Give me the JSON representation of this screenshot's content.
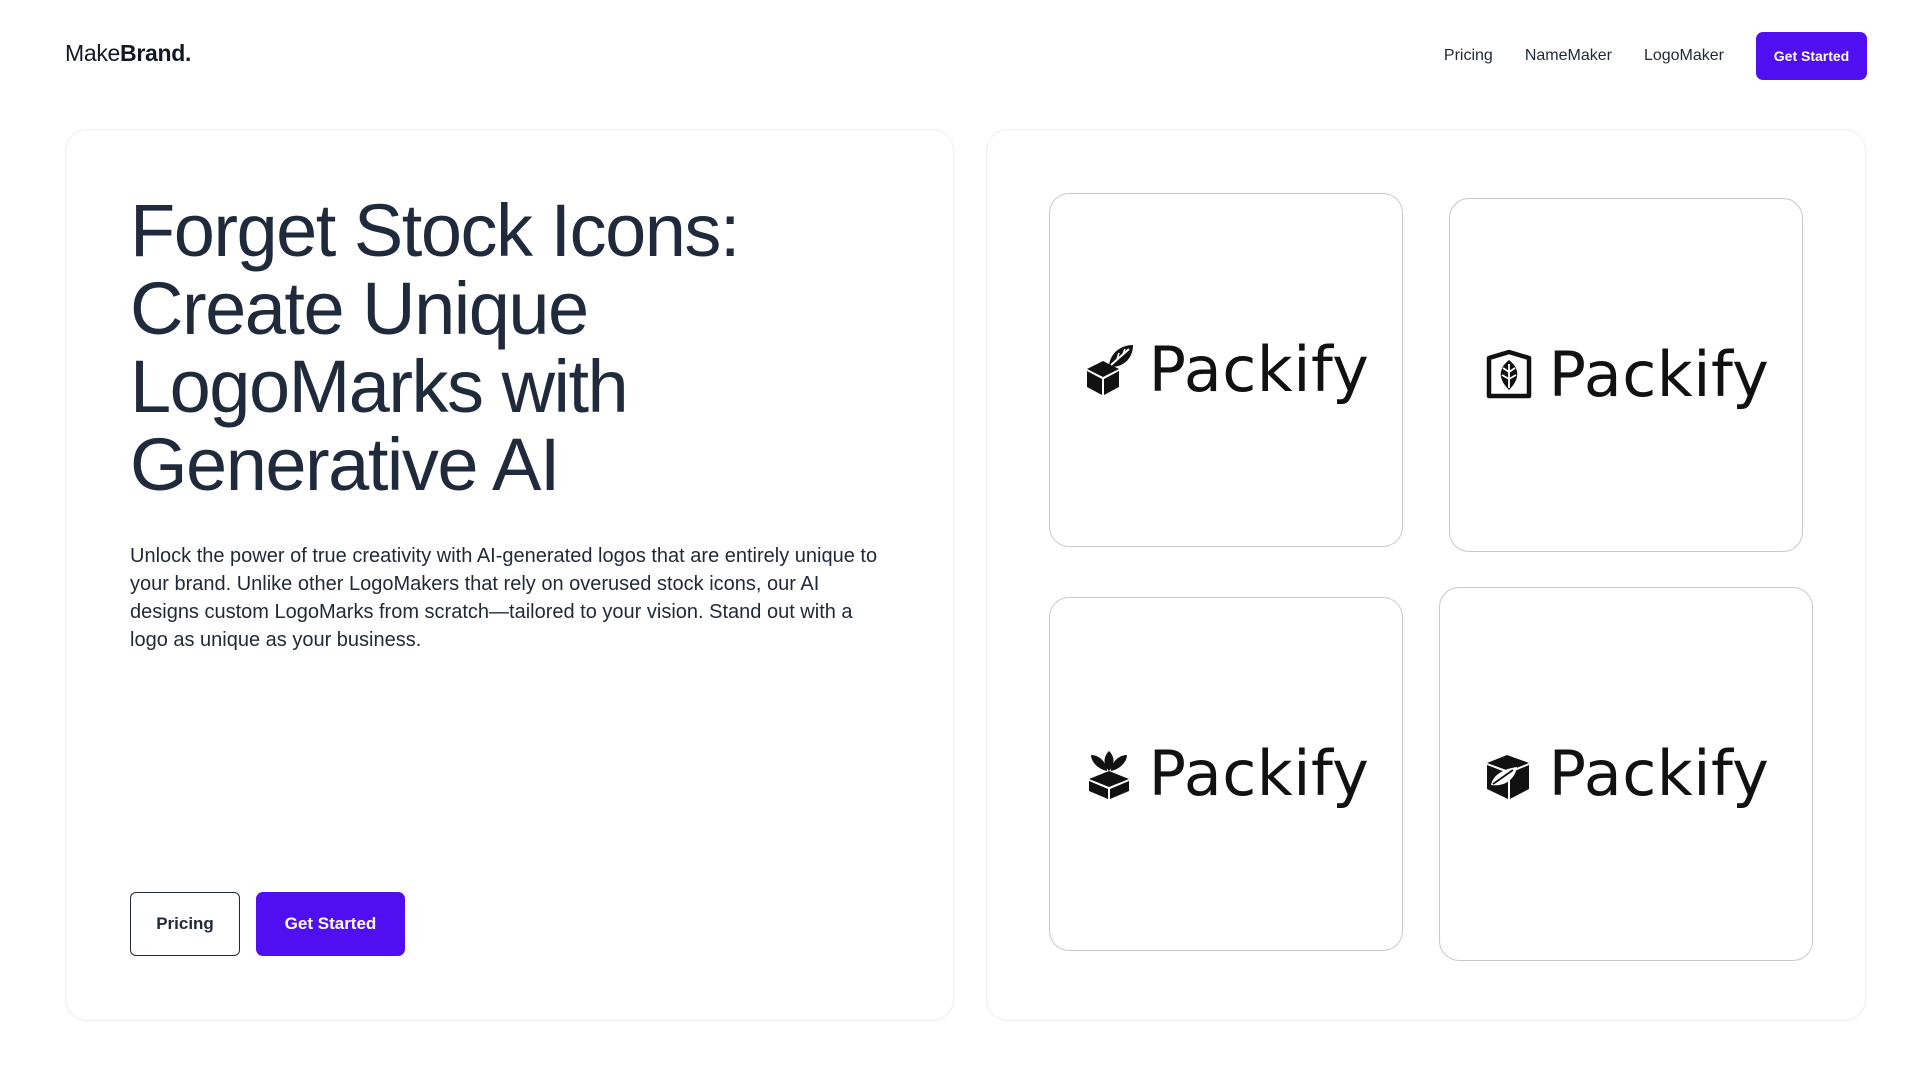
{
  "header": {
    "brand_regular": "Make",
    "brand_bold": "Brand.",
    "nav": [
      "Pricing",
      "NameMaker",
      "LogoMaker"
    ],
    "cta": "Get Started"
  },
  "hero": {
    "headline_lines": [
      "Forget Stock Icons:",
      "Create Unique",
      "LogoMarks with",
      "Generative AI"
    ],
    "description": "Unlock the power of true creativity with AI-generated logos that are entirely unique to your brand. Unlike other LogoMakers that rely on overused stock icons, our AI designs custom LogoMarks from scratch—tailored to your vision. Stand out with a logo as unique as your business.",
    "secondary_button": "Pricing",
    "primary_button": "Get Started"
  },
  "showcase": {
    "logos": [
      {
        "wordmark": "Packify",
        "icon": "box-leaf-icon"
      },
      {
        "wordmark": "Packify",
        "icon": "shield-leaf-icon"
      },
      {
        "wordmark": "Packify",
        "icon": "sprout-box-icon"
      },
      {
        "wordmark": "Packify",
        "icon": "cube-leaf-icon"
      }
    ]
  },
  "colors": {
    "accent": "#4f0ff0",
    "text": "#1f2a3c",
    "card_border": "#ececee",
    "tile_border": "#c9c9cc"
  }
}
